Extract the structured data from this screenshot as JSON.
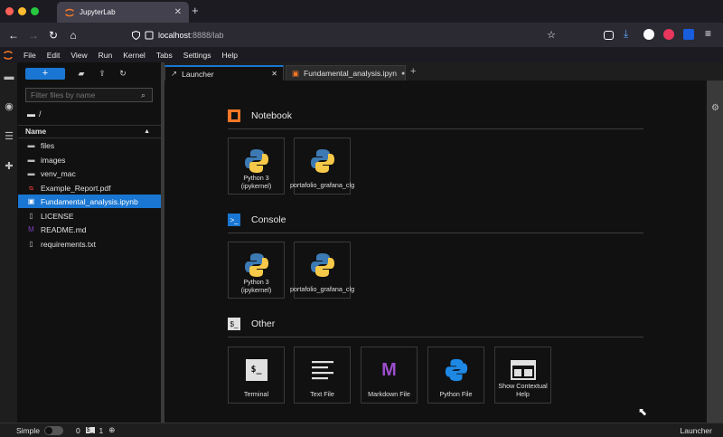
{
  "browser": {
    "tab_title": "JupyterLab",
    "tab_close": "✕",
    "new_tab": "+",
    "url_host": "localhost",
    "url_rest": ":8888/lab"
  },
  "menubar": {
    "items": [
      "File",
      "Edit",
      "View",
      "Run",
      "Kernel",
      "Tabs",
      "Settings",
      "Help"
    ]
  },
  "filebrowser": {
    "new_label": "+",
    "filter_placeholder": "Filter files by name",
    "breadcrumb": "/",
    "column_name": "Name",
    "files": [
      {
        "name": "files",
        "type": "folder"
      },
      {
        "name": "images",
        "type": "folder"
      },
      {
        "name": "venv_mac",
        "type": "folder"
      },
      {
        "name": "Example_Report.pdf",
        "type": "pdf"
      },
      {
        "name": "Fundamental_analysis.ipynb",
        "type": "notebook"
      },
      {
        "name": "LICENSE",
        "type": "file"
      },
      {
        "name": "README.md",
        "type": "markdown"
      },
      {
        "name": "requirements.txt",
        "type": "file"
      }
    ]
  },
  "doc_tabs": {
    "launcher": "Launcher",
    "launcher_close": "✕",
    "notebook": "Fundamental_analysis.ipyn",
    "add": "+"
  },
  "launcher": {
    "notebook_section": "Notebook",
    "console_section": "Console",
    "other_section": "Other",
    "console_icon_text": ">_",
    "other_icon_text": "$_",
    "notebook_cards": [
      {
        "label": "Python 3 (ipykernel)"
      },
      {
        "label": "portafolio_grafana_clg"
      }
    ],
    "console_cards": [
      {
        "label": "Python 3 (ipykernel)"
      },
      {
        "label": "portafolio_grafana_clg"
      }
    ],
    "other_cards": [
      {
        "label": "Terminal",
        "glyph": "$_"
      },
      {
        "label": "Text File"
      },
      {
        "label": "Markdown File",
        "glyph": "M"
      },
      {
        "label": "Python File"
      },
      {
        "label": "Show Contextual Help"
      }
    ]
  },
  "statusbar": {
    "mode": "Simple",
    "count_a": "0",
    "count_b": "1",
    "right": "Launcher"
  }
}
